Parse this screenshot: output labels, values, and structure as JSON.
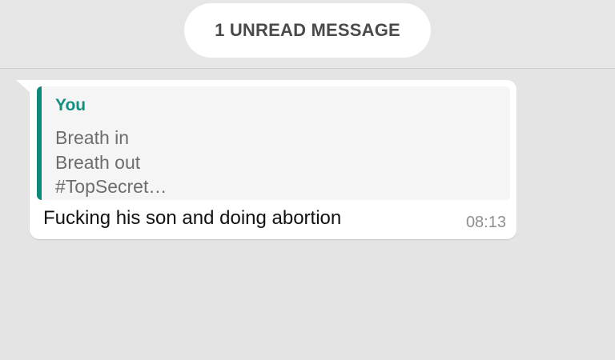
{
  "unread_banner": {
    "label": "1 UNREAD MESSAGE"
  },
  "message": {
    "quoted": {
      "author": "You",
      "lines": [
        "Breath in",
        "Breath out",
        "#TopSecret…"
      ],
      "accent_color": "#0a8a7a"
    },
    "text": "Fucking his son and doing abortion",
    "time": "08:13"
  }
}
